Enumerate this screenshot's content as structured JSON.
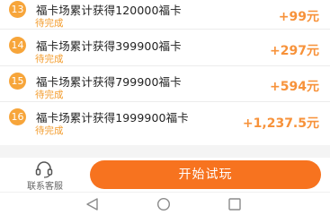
{
  "tasks": [
    {
      "index": "13",
      "title": "福卡场累计获得120000福卡",
      "status": "待完成",
      "reward": "+99元"
    },
    {
      "index": "14",
      "title": "福卡场累计获得399900福卡",
      "status": "待完成",
      "reward": "+297元"
    },
    {
      "index": "15",
      "title": "福卡场累计获得799900福卡",
      "status": "待完成",
      "reward": "+594元"
    },
    {
      "index": "16",
      "title": "福卡场累计获得1999900福卡",
      "status": "待完成",
      "reward": "+1,237.5元"
    }
  ],
  "action_bar": {
    "customer_service_label": "联系客服",
    "customer_service_icon": "headset-icon",
    "start_button_label": "开始试玩"
  },
  "system_nav": {
    "back_icon": "back-triangle-icon",
    "home_icon": "home-circle-icon",
    "recent_icon": "recent-square-icon"
  },
  "colors": {
    "badge": "#f7a53a",
    "status_text": "#f39c2c",
    "reward_text": "#f7923a",
    "start_button": "#f7731f"
  }
}
